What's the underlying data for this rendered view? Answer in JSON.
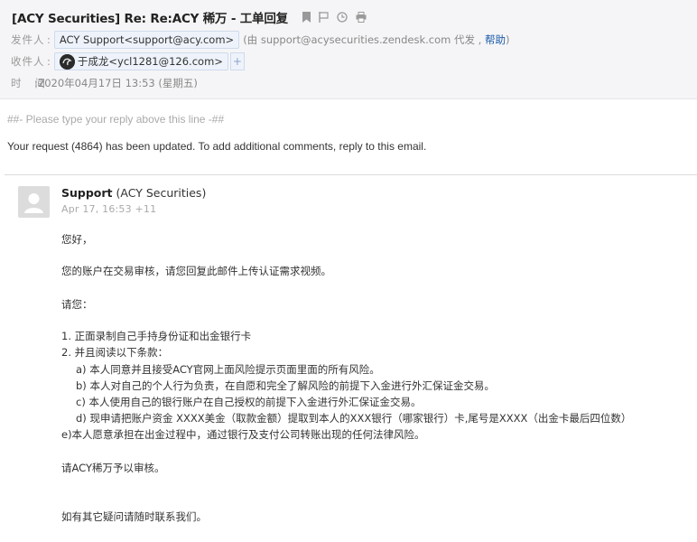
{
  "header": {
    "subject": "[ACY Securities] Re: Re:ACY 稀万 - 工单回复",
    "icons": [
      "bookmark-icon",
      "flag-icon",
      "clock-icon",
      "print-icon"
    ],
    "from_label": "发件人",
    "from_sep": ":",
    "from_chip": "ACY Support<support@acy.com>",
    "from_via_prefix": "(由 support@acysecurities.zendesk.com 代发 , ",
    "from_via_help": "帮助",
    "from_via_suffix": ")",
    "to_label": "收件人",
    "to_sep": ":",
    "to_chip": "于成龙<ycl1281@126.com>",
    "add_symbol": "+",
    "time_label": "时   间",
    "time_value": ":2020年04月17日 13:53 (星期五)"
  },
  "body": {
    "reply_line": "##- Please type your reply above this line -##",
    "updated_line": "Your request (4864) has been updated. To add additional comments, reply to this email.",
    "sender_name": "Support",
    "sender_org": " (ACY Securities)",
    "date": "Apr 17, 16:53 +11",
    "greeting": "您好，",
    "line1": "您的账户在交易审核，请您回复此邮件上传认证需求视频。",
    "line2": "请您：",
    "item1": "1. 正面录制自己手持身份证和出金银行卡",
    "item2": "2. 并且阅读以下条款：",
    "sub_a": "a) 本人同意并且接受ACY官网上面风险提示页面里面的所有风险。",
    "sub_b": "b) 本人对自己的个人行为负责，在自愿和完全了解风险的前提下入金进行外汇保证金交易。",
    "sub_c": "c) 本人使用自己的银行账户在自己授权的前提下入金进行外汇保证金交易。",
    "sub_d": "d) 现申请把账户资金 XXXX美金（取款金额）提取到本人的XXX银行（哪家银行）卡,尾号是XXXX（出金卡最后四位数）",
    "sub_e": "e)本人愿意承担在出金过程中，通过银行及支付公司转账出现的任何法律风险。",
    "request": "请ACY稀万予以审核。",
    "closing": "如有其它疑问请随时联系我们。"
  },
  "colors": {
    "header_bg": "#f5f5f7",
    "chip_bg": "#eef3fb",
    "link": "#1a5aa8"
  }
}
